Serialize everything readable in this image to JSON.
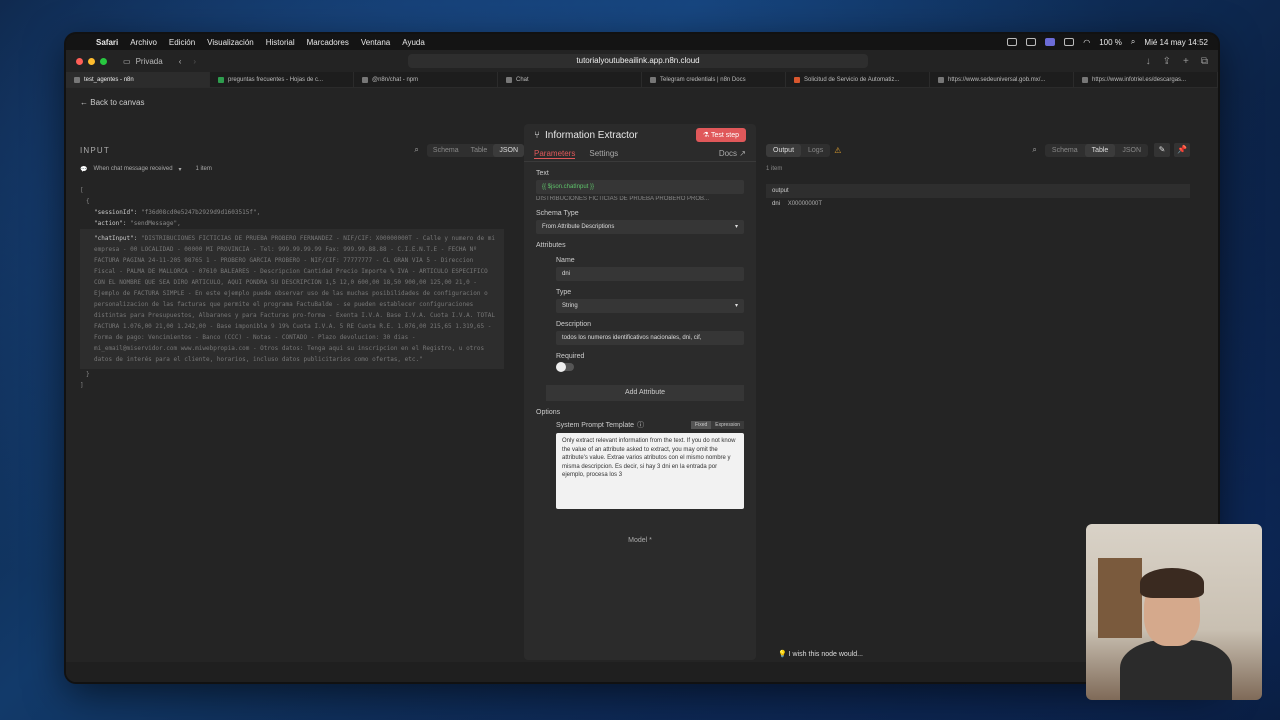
{
  "menubar": {
    "items": [
      "Safari",
      "Archivo",
      "Edición",
      "Visualización",
      "Historial",
      "Marcadores",
      "Ventana",
      "Ayuda"
    ],
    "battery": "100 %",
    "datetime": "Mié 14 may 14:52"
  },
  "browser": {
    "private_label": "Privada",
    "url": "tutorialyoutubeailink.app.n8n.cloud",
    "tabs": [
      "test_agentes - n8n",
      "preguntas frecuentes - Hojas de c...",
      "@n8n/chat - npm",
      "Chat",
      "Telegram credentials | n8n Docs",
      "Solicitud de Servicio de Automatiz...",
      "https://www.sedeuniversal.gob.mx/...",
      "https://www.infotriel.es/descargas..."
    ]
  },
  "app": {
    "back_label": "Back to canvas",
    "input": {
      "title": "INPUT",
      "view_modes": [
        "Schema",
        "Table",
        "JSON"
      ],
      "trigger_label": "When chat message received",
      "item_count": "1 item",
      "json_keys": {
        "session_id_key": "\"sessionId\":",
        "session_id_val": "\"f36d08cd0e5247b2929d9d1603515f\",",
        "action_key": "\"action\":",
        "action_val": "\"sendMessage\",",
        "chat_input_key": "\"chatInput\":"
      },
      "chat_input_text": "\"DISTRIBUCIONES FICTICIAS DE PRUEBA PROBERO FERNANDEZ - NIF/CIF: X00000000T - Calle y numero de mi empresa - 00 LOCALIDAD - 00000 MI PROVINCIA - Tel: 999.99.99.99 Fax: 999.99.88.88 - C.I.E.N.T.E - FECHA Nº FACTURA PAGINA 24-11-205 98765 1 - PROBERO GARCIA PROBERO - NIF/CIF: 77777777 - CL GRAN VIA 5 - Direccion Fiscal - PALMA DE MALLORCA - 07610 BALEARES - Descripcion Cantidad Precio Importe % IVA - ARTICULO ESPECIFICO CON EL NOMBRE QUE SEA DIRO ARTICULO, AQUI PONDRA SU DESCRIPCION 1,5 12,0 600,00 18,50 900,00 125,00 21,0 - Ejemplo de FACTURA SIMPLE - En este ejemplo puede observar uso de las muchas posibilidades de configuracion o personalizacion de las facturas que permite el programa FactuBalde - se pueden establecer configuraciones distintas para Presupuestos, Albaranes y para Facturas pro-forma - Exenta I.V.A. Base I.V.A. Cuota I.V.A. TOTAL FACTURA 1.076,00 21,00 1.242,00 - Base imponible 9 19% Cuota I.V.A. 5 RE Cuota R.E. 1.076,00 215,65 1.319,65 - Forma de pago: Vencimientos - Banco (CCC) - Notas - CONTADO - Plazo devolucion: 30 dias - mi_email@miservidor.com www.miwebpropia.com - Otros datos: Tenga aqui su inscripcion en el Registro, u otros datos de interés para el cliente, horarios, incluso datos publicitarios como ofertas, etc.\""
    },
    "node": {
      "title": "Information Extractor",
      "test_step_label": "Test step",
      "tabs": [
        "Parameters",
        "Settings"
      ],
      "docs_label": "Docs",
      "text_label": "Text",
      "text_expression": "{{ $json.chatInput }}",
      "text_preview": "DISTRIBUCIONES FICTICIAS DE PRUEBA PROBERO PROB...",
      "schema_type_label": "Schema Type",
      "schema_type_value": "From Attribute Descriptions",
      "attributes_label": "Attributes",
      "name_label": "Name",
      "name_value": "dni",
      "type_label": "Type",
      "type_value": "String",
      "description_label": "Description",
      "description_value": "todos los numeros identificativos nacionales, dni, cif,",
      "required_label": "Required",
      "add_attribute_label": "Add Attribute",
      "options_label": "Options",
      "system_prompt_label": "System Prompt Template",
      "fixed_label": "Fixed",
      "expression_label": "Expression",
      "system_prompt_text": "Only extract relevant information from the text. If you do not know the value of an attribute asked to extract, you may omit the attribute's value. Extrae varios atributos con el mismo nombre y misma descripcion. Es decir, si hay 3 dni en la entrada por ejemplo, procesa los 3",
      "model_label": "Model *"
    },
    "output": {
      "tabs": [
        "Output",
        "Logs"
      ],
      "view_modes": [
        "Schema",
        "Table",
        "JSON"
      ],
      "item_count": "1 item",
      "header": "output",
      "row_key": "dni",
      "row_value": "X00000000T"
    },
    "wish_label": "I wish this node would..."
  }
}
